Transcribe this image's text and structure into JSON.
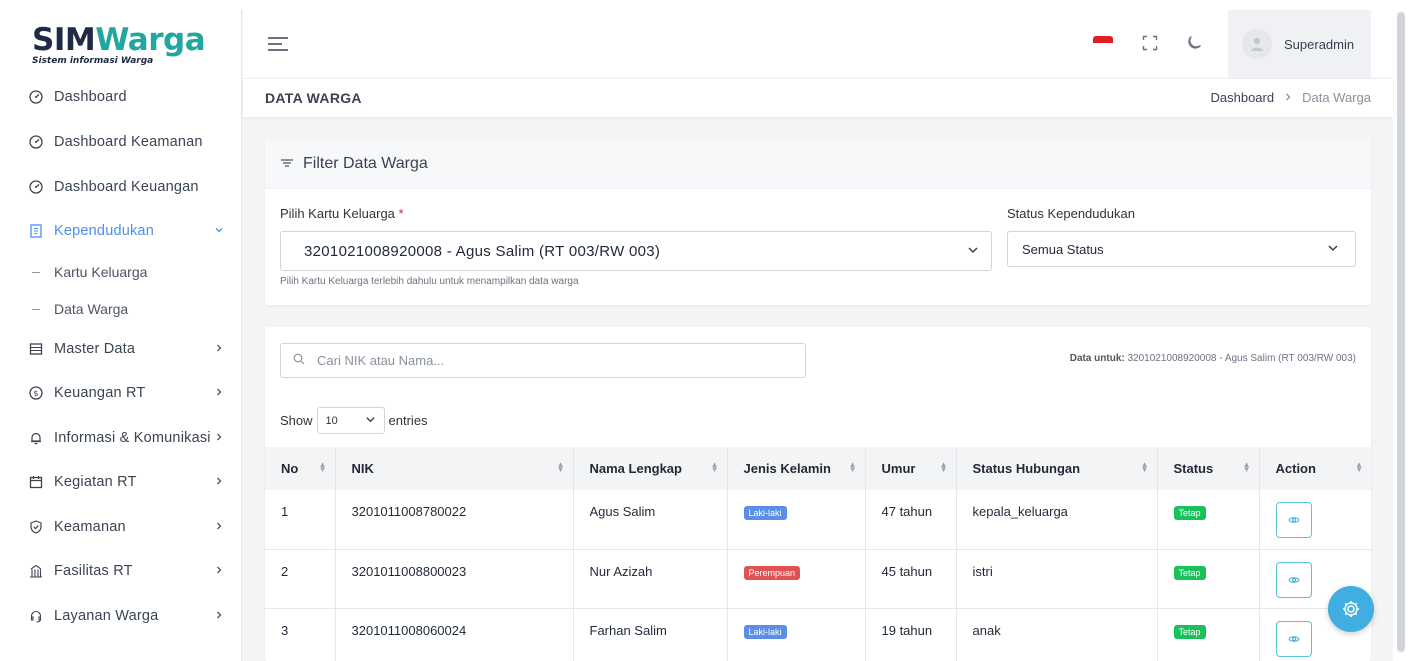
{
  "app": {
    "logo_sim": "SIM",
    "logo_warga": "Warga",
    "logo_tagline": "Sistem informasi Warga"
  },
  "sidebar": {
    "items": [
      {
        "label": "Dashboard",
        "icon": "gauge-icon"
      },
      {
        "label": "Dashboard Keamanan",
        "icon": "gauge-icon"
      },
      {
        "label": "Dashboard Keuangan",
        "icon": "gauge-icon"
      },
      {
        "label": "Kependudukan",
        "icon": "book-icon",
        "active": true
      },
      {
        "label": "Master Data",
        "icon": "database-icon"
      },
      {
        "label": "Keuangan RT",
        "icon": "dollar-icon"
      },
      {
        "label": "Informasi & Komunikasi",
        "icon": "bell-icon"
      },
      {
        "label": "Kegiatan RT",
        "icon": "calendar-icon"
      },
      {
        "label": "Keamanan",
        "icon": "shield-icon"
      },
      {
        "label": "Fasilitas RT",
        "icon": "building-icon"
      },
      {
        "label": "Layanan Warga",
        "icon": "headset-icon"
      }
    ],
    "sub_items": [
      "Kartu Keluarga",
      "Data Warga"
    ]
  },
  "header": {
    "user_name": "Superadmin"
  },
  "page": {
    "title": "DATA WARGA",
    "breadcrumb": [
      "Dashboard",
      "Data Warga"
    ]
  },
  "filter": {
    "title": "Filter Data Warga",
    "kk_label": "Pilih Kartu Keluarga",
    "kk_required": "*",
    "kk_value": "3201021008920008 - Agus Salim (RT 003/RW 003)",
    "kk_help": "Pilih Kartu Keluarga terlebih dahulu untuk menampilkan data warga",
    "status_label": "Status Kependudukan",
    "status_value": "Semua Status"
  },
  "table_section": {
    "search_placeholder": "Cari NIK atau Nama...",
    "data_for_label": "Data untuk:",
    "data_for_value": "3201021008920008 - Agus Salim (RT 003/RW 003)",
    "show_label": "Show",
    "page_length": "10",
    "entries_label": "entries",
    "columns": [
      "No",
      "NIK",
      "Nama Lengkap",
      "Jenis Kelamin",
      "Umur",
      "Status Hubungan",
      "Status",
      "Action"
    ],
    "rows": [
      {
        "no": "1",
        "nik": "3201011008780022",
        "nama": "Agus Salim",
        "jk": "Laki-laki",
        "umur": "47 tahun",
        "hubungan": "kepala_keluarga",
        "status": "Tetap"
      },
      {
        "no": "2",
        "nik": "3201011008800023",
        "nama": "Nur Azizah",
        "jk": "Perempuan",
        "umur": "45 tahun",
        "hubungan": "istri",
        "status": "Tetap"
      },
      {
        "no": "3",
        "nik": "3201011008060024",
        "nama": "Farhan Salim",
        "jk": "Laki-laki",
        "umur": "19 tahun",
        "hubungan": "anak",
        "status": "Tetap"
      }
    ]
  },
  "colors": {
    "accent": "#4a8ff0",
    "teal": "#22a7a0",
    "male_badge": "#5b8ee6",
    "female_badge": "#e05353",
    "status_badge": "#18c15a",
    "fab": "#40aee0"
  }
}
